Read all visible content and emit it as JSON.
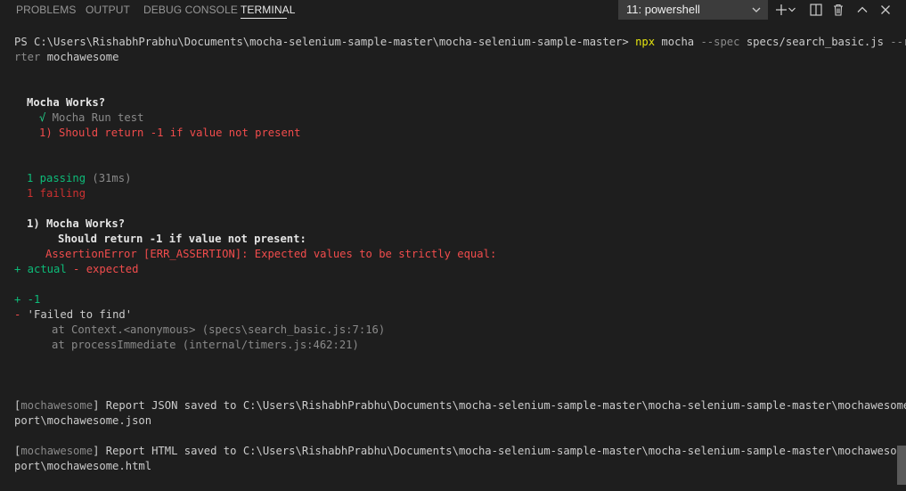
{
  "tabs": [
    {
      "label": "PROBLEMS"
    },
    {
      "label": "OUTPUT"
    },
    {
      "label": "DEBUG CONSOLE"
    },
    {
      "label": "TERMINAL"
    }
  ],
  "shell_select": {
    "value": "11: powershell"
  },
  "toolbar_icons": [
    "plus-icon",
    "split-icon",
    "trash-icon",
    "chevron-up-icon",
    "close-icon"
  ],
  "terminal": {
    "prompt": "PS C:\\Users\\RishabhPrabhu\\Documents\\mocha-selenium-sample-master\\mocha-selenium-sample-master>",
    "cmd_npx": "npx",
    "cmd_mocha": " mocha",
    "cmd_spec_flag": " --spec",
    "cmd_spec_value": " specs/search_basic.js",
    "cmd_reporter_flag_1": " --repo",
    "cmd_reporter_flag_2": "rter",
    "cmd_reporter_value": " mochawesome",
    "suite_title": "Mocha Works?",
    "pass_mark": "√",
    "pass_test": " Mocha Run test",
    "fail_test": "1) Should return -1 if value not present",
    "passing_count": "1 passing",
    "passing_time": " (31ms)",
    "failing_count": "1 failing",
    "fail_header": "1) Mocha Works?",
    "fail_title": "Should return -1 if value not present:",
    "assertion_error": "AssertionError [ERR_ASSERTION]: Expected values to be strictly equal:",
    "diff_actual": "+ actual",
    "diff_expected": " - expected",
    "diff_plus_line": "+ -1",
    "diff_minus_prefix": "-",
    "diff_minus_value": " 'Failed to find'",
    "stack_1": "at Context.<anonymous> (specs\\search_basic.js:7:16)",
    "stack_2": "at processImmediate (internal/timers.js:462:21)",
    "report_bracket_open": "[",
    "report_tag": "mochawesome",
    "json_report_line1": "] Report JSON saved to C:\\Users\\RishabhPrabhu\\Documents\\mocha-selenium-sample-master\\mocha-selenium-sample-master\\mochawesome-re",
    "json_report_line2": "port\\mochawesome.json",
    "html_report_line1": "] Report HTML saved to C:\\Users\\RishabhPrabhu\\Documents\\mocha-selenium-sample-master\\mocha-selenium-sample-master\\mochawesome-re",
    "html_report_line2": "port\\mochawesome.html"
  }
}
